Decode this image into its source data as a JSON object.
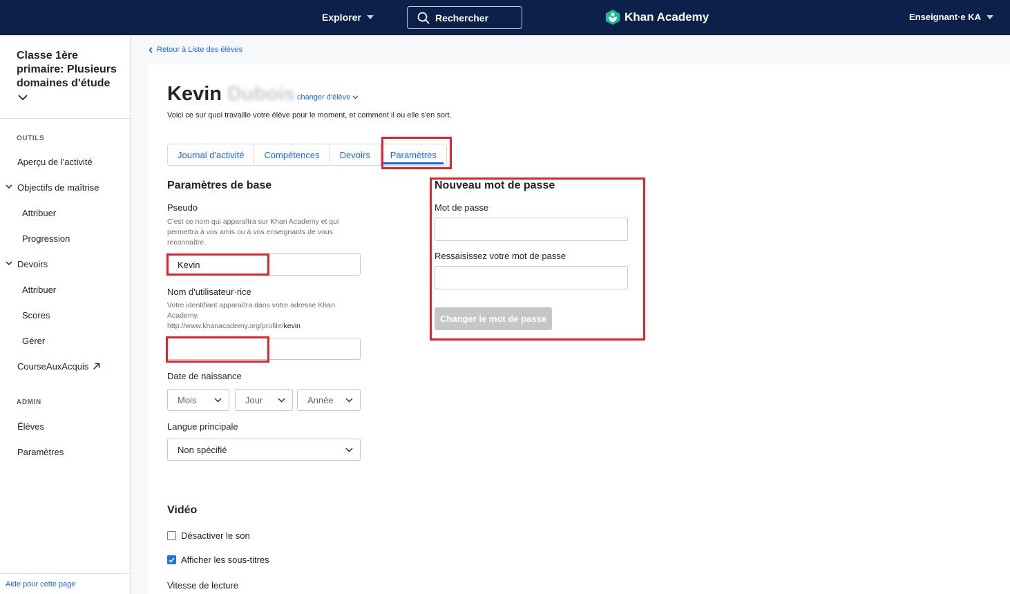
{
  "topbar": {
    "explore_label": "Explorer",
    "search_label": "Rechercher",
    "logo_text": "Khan Academy",
    "user_label": "Enseignant·e KA"
  },
  "sidebar": {
    "class_title": "Classe 1ère primaire: Plusieurs domaines d'étude",
    "tools_heading": "OUTILS",
    "items": [
      {
        "label": "Aperçu de l'activité"
      },
      {
        "label": "Objectifs de maîtrise"
      },
      {
        "label": "Attribuer"
      },
      {
        "label": "Progression"
      },
      {
        "label": "Devoirs"
      },
      {
        "label": "Attribuer"
      },
      {
        "label": "Scores"
      },
      {
        "label": "Gérer"
      },
      {
        "label": "CourseAuxAcquis"
      }
    ],
    "admin_heading": "ADMIN",
    "admin_items": [
      {
        "label": "Élèves"
      },
      {
        "label": "Paramètres"
      }
    ],
    "help_link": "Aide pour cette page"
  },
  "main": {
    "back_link": "Retour à Liste des élèves",
    "student_first_name": "Kevin",
    "student_last_name": "Dubois",
    "change_student": "changer d'élève",
    "subtitle": "Voici ce sur quoi travaille votre élève pour le moment, et comment il ou elle s'en sort.",
    "tabs": [
      {
        "label": "Journal d'activité"
      },
      {
        "label": "Compétences"
      },
      {
        "label": "Devoirs"
      },
      {
        "label": "Paramètres"
      }
    ],
    "basic": {
      "heading": "Paramètres de base",
      "nickname_label": "Pseudo",
      "nickname_help": "C'est ce nom qui apparaîtra sur Khan Academy et qui permettra à vos amis ou à vos enseignants de vous reconnaître.",
      "nickname_value": "Kevin",
      "username_label": "Nom d'utilisateur·rice",
      "username_help": "Votre identifiant apparaîtra dans votre adresse Khan Academy.",
      "profile_url_prefix": "http://www.khanacademy.org/profile/",
      "profile_url_user": "kevin",
      "birth_label": "Date de naissance",
      "month_placeholder": "Mois",
      "day_placeholder": "Jour",
      "year_placeholder": "Année",
      "language_label": "Langue principale",
      "language_value": "Non spécifié"
    },
    "password": {
      "heading": "Nouveau mot de passe",
      "password_label": "Mot de passe",
      "confirm_label": "Ressaisissez votre mot de passe",
      "button_label": "Changer le mot de passe"
    },
    "video": {
      "heading": "Vidéo",
      "mute_label": "Désactiver le son",
      "mute_checked": false,
      "subtitles_label": "Afficher les sous-titres",
      "subtitles_checked": true,
      "speed_label": "Vitesse de lecture"
    }
  },
  "colors": {
    "nav_bg": "#0b2149",
    "link_blue": "#1865f2",
    "highlight_red": "#e8202a",
    "logo_green": "#14bf96"
  }
}
